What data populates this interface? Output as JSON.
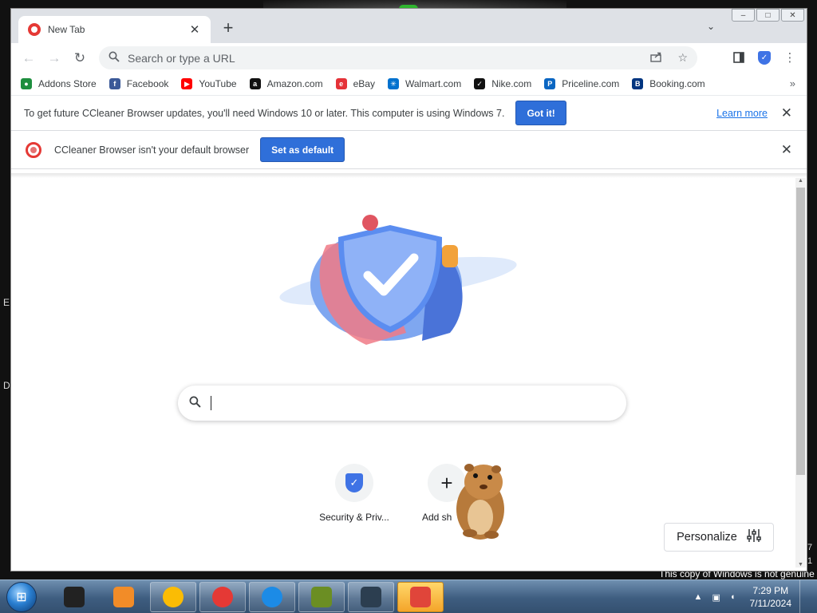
{
  "browser": {
    "tab": {
      "title": "New Tab",
      "close_glyph": "✕"
    },
    "new_tab_glyph": "+",
    "tab_search_glyph": "⌄",
    "window_controls": {
      "minimize": "–",
      "maximize": "□",
      "close": "✕"
    },
    "nav": {
      "back": "←",
      "forward": "→",
      "reload": "↻"
    },
    "omnibox": {
      "placeholder": "Search or type a URL",
      "value": ""
    },
    "toolbar_icons": [
      "share-icon",
      "star-icon",
      "side-panel-icon",
      "security-shield-icon",
      "menu-icon"
    ],
    "bookmarks": [
      {
        "label": "Addons Store",
        "icon": "addons-store-icon",
        "color": "#1e8e3e",
        "glyph": "●"
      },
      {
        "label": "Facebook",
        "icon": "facebook-icon",
        "color": "#3b5998",
        "glyph": "f"
      },
      {
        "label": "YouTube",
        "icon": "youtube-icon",
        "color": "#ff0000",
        "glyph": "▶"
      },
      {
        "label": "Amazon.com",
        "icon": "amazon-icon",
        "color": "#111111",
        "glyph": "a"
      },
      {
        "label": "eBay",
        "icon": "ebay-icon",
        "color": "#e53238",
        "glyph": "e"
      },
      {
        "label": "Walmart.com",
        "icon": "walmart-icon",
        "color": "#0071ce",
        "glyph": "✳"
      },
      {
        "label": "Nike.com",
        "icon": "nike-icon",
        "color": "#111111",
        "glyph": "✓"
      },
      {
        "label": "Priceline.com",
        "icon": "priceline-icon",
        "color": "#0a66c2",
        "glyph": "P"
      },
      {
        "label": "Booking.com",
        "icon": "booking-icon",
        "color": "#003580",
        "glyph": "B"
      }
    ],
    "bookmarks_more": "»"
  },
  "infobars": {
    "update": {
      "text": "To get future CCleaner Browser updates, you'll need Windows 10 or later. This computer is using Windows 7.",
      "button": "Got it!",
      "link": "Learn more",
      "close": "✕"
    },
    "default_browser": {
      "text": "CCleaner Browser isn't your default browser",
      "button": "Set as default",
      "close": "✕"
    }
  },
  "newtab": {
    "search_placeholder": "",
    "shortcuts": [
      {
        "label": "Security & Priv...",
        "icon": "security-shield-icon"
      },
      {
        "label": "Add sh",
        "icon": "plus-icon"
      }
    ],
    "personalize_label": "Personalize"
  },
  "desktop": {
    "watermark": "This copy of Windows is not genuine",
    "left_fragments": [
      "E",
      "D"
    ],
    "right_fragments": [
      "7",
      "1"
    ]
  },
  "taskbar": {
    "apps": [
      {
        "name": "taskbar-app-black-box",
        "color": "#222222"
      },
      {
        "name": "taskbar-app-media-player",
        "color": "#f28c28"
      },
      {
        "name": "taskbar-app-chrome",
        "color": "#fbbc04"
      },
      {
        "name": "taskbar-app-ccleaner-browser",
        "color": "#e53935"
      },
      {
        "name": "taskbar-app-edge",
        "color": "#1c8be6"
      },
      {
        "name": "taskbar-app-box-game",
        "color": "#6b8e23"
      },
      {
        "name": "taskbar-app-monitor",
        "color": "#2c3e50"
      },
      {
        "name": "taskbar-app-users",
        "color": "#e0453a"
      }
    ],
    "clock": {
      "time": "7:29 PM",
      "date": "7/11/2024"
    }
  }
}
